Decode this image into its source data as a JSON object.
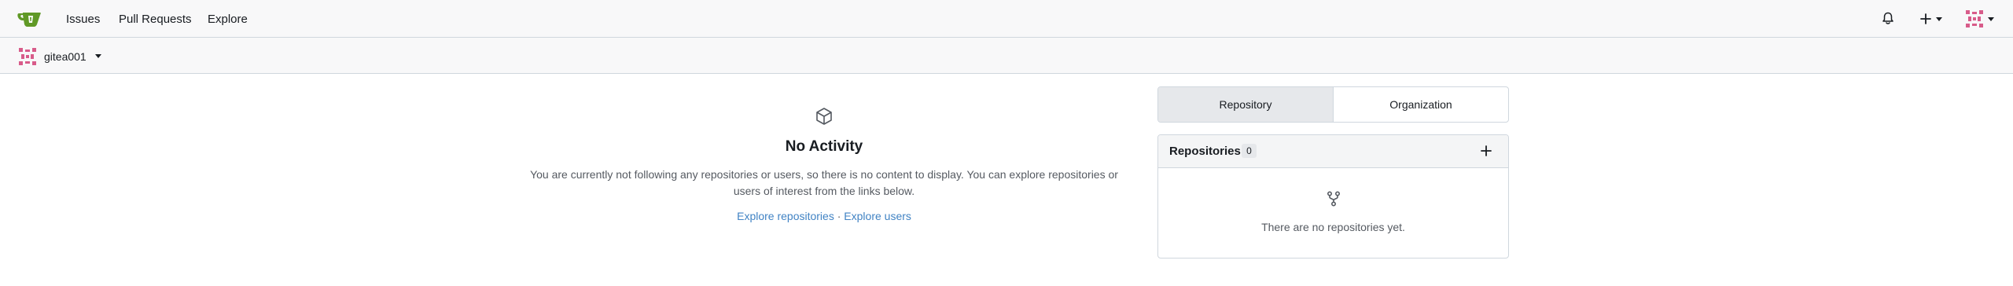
{
  "navbar": {
    "logo_icon": "gitea-teapot-icon",
    "links": [
      "Issues",
      "Pull Requests",
      "Explore"
    ],
    "notifications_icon": "bell-icon",
    "create_icon": "plus-icon",
    "user_avatar_icon": "identicon-avatar-icon"
  },
  "context": {
    "username": "gitea001"
  },
  "feed": {
    "icon": "package-icon",
    "title": "No Activity",
    "description": "You are currently not following any repositories or users, so there is no content to display. You can explore repositories or users of interest from the links below.",
    "explore_repos": "Explore repositories",
    "separator": "·",
    "explore_users": "Explore users"
  },
  "panel": {
    "tabs": [
      "Repository",
      "Organization"
    ],
    "active_tab": "Repository",
    "repos_title": "Repositories",
    "repos_count": "0",
    "add_icon": "plus-icon",
    "empty_icon": "repo-forked-icon",
    "empty_text": "There are no repositories yet."
  },
  "colors": {
    "accent": "#609926",
    "link": "#4183c4",
    "avatar": "#d85c8a",
    "muted_text": "#555a61"
  }
}
